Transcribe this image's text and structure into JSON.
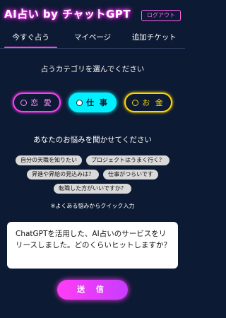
{
  "header": {
    "logo_text": "AI占い by チャットGPT",
    "logout_label": "ログアウト"
  },
  "tabs": [
    {
      "label": "今すぐ占う",
      "active": true
    },
    {
      "label": "マイページ",
      "active": false
    },
    {
      "label": "追加チケット",
      "active": false
    }
  ],
  "category_prompt": "占うカテゴリを選んでください",
  "categories": [
    {
      "label": "恋 愛",
      "selected": false,
      "color": "#ff3df5"
    },
    {
      "label": "仕 事",
      "selected": true,
      "color": "#00f0ff"
    },
    {
      "label": "お 金",
      "selected": false,
      "color": "#ffd700"
    }
  ],
  "worry_prompt": "あなたのお悩みを聞かせてください",
  "quick_chips": [
    "自分の天職を知りたい",
    "プロジェクトはうまく行く？",
    "昇進や昇給の見込みは？",
    "仕事がつらいです",
    "転職した方がいいですか？"
  ],
  "quick_note": "※よくある悩みからクイック入力",
  "input": {
    "value": "ChatGPTを活用した、AI占いのサービスをリリースしました。どのくらいヒットしますか？"
  },
  "send_label": "送 信",
  "colors": {
    "background": "#0d1a33",
    "accent_pink": "#ff3df5",
    "accent_cyan": "#00f0ff",
    "accent_gold": "#ffd700"
  }
}
